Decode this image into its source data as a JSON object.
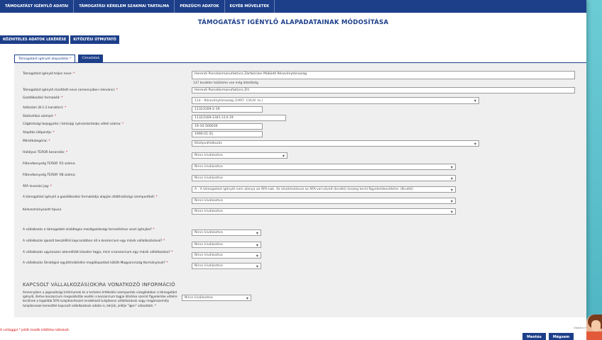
{
  "topnav": [
    "TÁMOGATÁST IGÉNYLŐ ADATAI",
    "TÁMOGATÁSI KÉRELEM SZAKMAI TARTALMA",
    "PÉNZÜGYI ADATOK",
    "EGYÉB MŰVELETEK"
  ],
  "page_title": "TÁMOGATÁST IGÉNYLŐ ALAPADATAINAK MÓDOSÍTÁSA",
  "subnav": [
    "KÖZHITELES ADATOK LEKÉRÉSE",
    "KITÖLTÉSI ÚTMUTATÓ"
  ],
  "tabs": [
    "Támogatást igénylő alapadatai *",
    "Címadatok"
  ],
  "fields": {
    "full_name": {
      "label": "Támogatást igénylő teljes neve:",
      "value": "Herendi Porcelánmanufaktúra Zártkörűen Működő Részvénytársaság"
    },
    "chars_left": "137 karakter leütésére van még lehetőség",
    "short_name": {
      "label": "Támogatást igénylő rövidített neve (amennyiben releváns):",
      "value": "Herendi Porcelánmanufaktúra Zrt."
    },
    "legal_form": {
      "label": "Gazdálkodási formakód:",
      "value": "114 - Részvénytársaság (1997. CXLIV. tv.)"
    },
    "tax_number": {
      "label": "Adószám (8-1-2 karakter):",
      "value": "11323169-2-19"
    },
    "stat_number": {
      "label": "Statisztikai számjel:",
      "value": "11323169-2341-114-19"
    },
    "registry_number": {
      "label": "Cégbírósági bejegyzési / bírósági nyilvántartásba vételi száma:",
      "value": "19-10-500030"
    },
    "founded": {
      "label": "Alapítás időpontja:",
      "value": "1990.01.01."
    },
    "sme_category": {
      "label": "Méretkategória:",
      "value": "Középvállalkozás"
    },
    "teaor_main": {
      "label": "Hatályos TEÁOR besorolás:",
      "value": "Nincs kiválasztva"
    },
    "teaor_03": {
      "label": "Főtevékenység TEÁOR '03 száma:",
      "value": "Nincs kiválasztva"
    },
    "teaor_08": {
      "label": "Főtevékenység TEÁOR '08 száma:",
      "value": "Nincs kiválasztva"
    },
    "vat": {
      "label": "ÁFA levonási jog:",
      "value": "A - A támogatást igénylő nem alanya az ÁFA-nak. Az elszámolással az ÁFA-val növelt (bruttó) összeg kerül figyelembevételre. (Bruttó)"
    },
    "ownership": {
      "label": "A támogatást igénylő a gazdálkodási formakódja alapján átláthatósági szempontból:",
      "value": "Nincs kiválasztva"
    },
    "beneficiary_type": {
      "label": "Kedvezményezett típusa",
      "value": "Nincs kiválasztva"
    }
  },
  "questions": [
    {
      "label": "A vállalkozás a támogatást elsődleges mezőgazdasági termeléshez veszi igénybe?",
      "value": "Nincs kiválasztva"
    },
    {
      "label": "A vállalkozás igazolt beszállítói kapcsolatban áll a konzorcium egy másik vállalkozásával?",
      "value": "Nincs kiválasztva"
    },
    {
      "label": "A vállalkozás ugyanazon akkreditált klaszter tagja, mint a konzorcium egy másik vállalkozása?",
      "value": "Nincs kiválasztva"
    },
    {
      "label": "A vállalkozás Stratégiai együttműködési megállapodást kötött Magyarország Kormányával?",
      "value": "Nincs kiválasztva"
    }
  ],
  "section2": {
    "title": "KAPCSOLT VÁLLALKOZÁS(OK)RA VONATKOZÓ INFORMÁCIÓ",
    "question": "Amennyiben a jogosultsági kritériumok és a tartalmi értékelési szempontok vizsgálatakor a támogatást igénylő, illetve konzorcium megvalósítás esetén a konzorcium tagjai döntése szerint figyelembe vételre kerülnek a legalább 50% tulajdonrésszel rendelkező tulajdonos vállalkozások vagy magánszemély tulajdonosok kereszttel kapcsolt vállalkozások adatai is, kérjük, jelölje \"Igen\" választást.",
    "value": "Nincs kiválasztva"
  },
  "required_marker": "*",
  "footnote": "A csillaggal * jelölt mezők kitöltése kötelező.",
  "save_note": "Utoljára mentve",
  "buttons": {
    "save": "Mentés",
    "cancel": "Mégsem"
  },
  "colors": {
    "nav": "#1d3f8a",
    "required": "#d40000",
    "background": "#5fc3cf"
  }
}
